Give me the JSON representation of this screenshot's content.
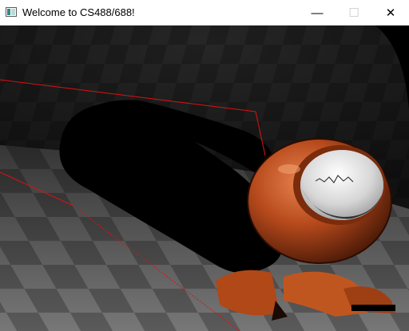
{
  "window": {
    "title": "Welcome to CS488/688!",
    "controls": {
      "minimize": "—",
      "maximize": "☐",
      "close": "✕"
    }
  },
  "scene": {
    "description_icons": [
      "checkerboard-floor",
      "checkerboard-wall",
      "shadow",
      "metal-sphere",
      "bounding-box"
    ],
    "colors": {
      "copper": "#b04818",
      "copper_highlight": "#e07a45",
      "shadow": "#000000",
      "floor_light": "#6e6e6e",
      "floor_dark": "#4d4d4d",
      "wall_light": "#2a2a2a",
      "wall_dark": "#1f1f1f",
      "bbox_line": "#e01010",
      "inner_sphere": "#e8e8e8"
    }
  }
}
